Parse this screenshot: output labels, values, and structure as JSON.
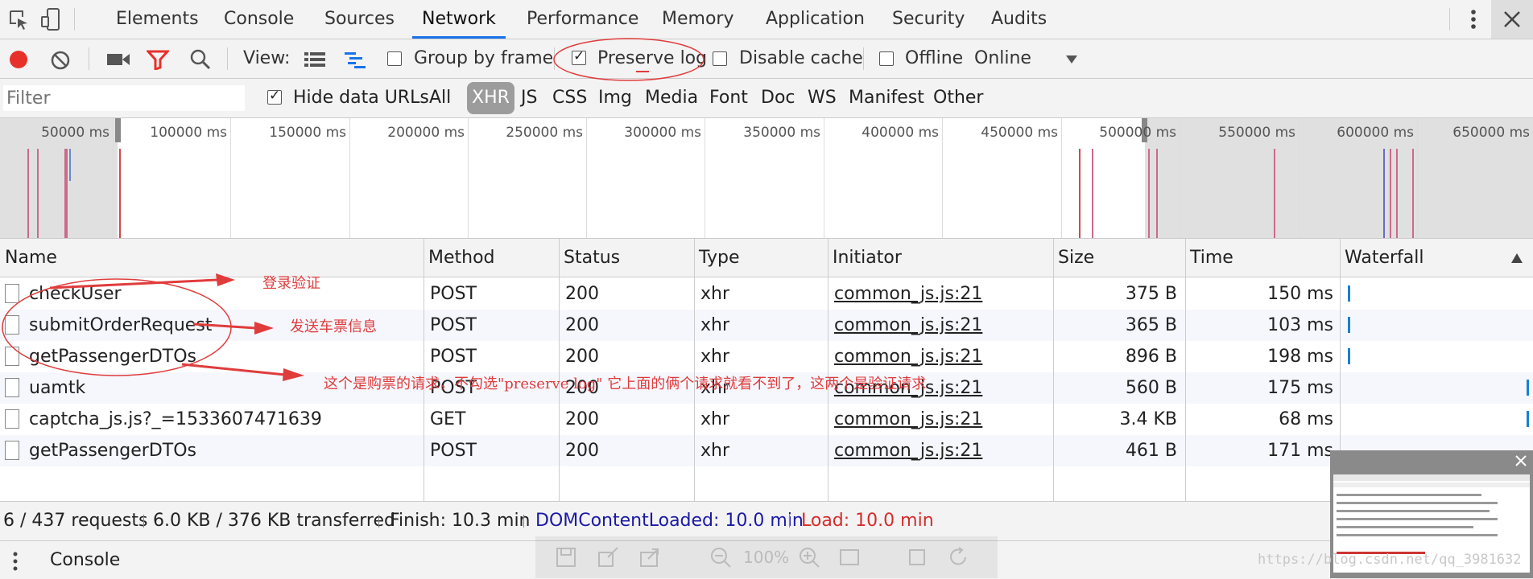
{
  "tabs": {
    "items": [
      "Elements",
      "Console",
      "Sources",
      "Network",
      "Performance",
      "Memory",
      "Application",
      "Security",
      "Audits"
    ],
    "active": "Network"
  },
  "toolbar": {
    "view_label": "View:",
    "group_by_frame": "Group by frame",
    "preserve_log": "Preserve log",
    "disable_cache": "Disable cache",
    "offline": "Offline",
    "throttle": "Online"
  },
  "filter": {
    "placeholder": "Filter",
    "hide_data_urls": "Hide data URLs",
    "types": [
      "All",
      "XHR",
      "JS",
      "CSS",
      "Img",
      "Media",
      "Font",
      "Doc",
      "WS",
      "Manifest",
      "Other"
    ],
    "active_type": "XHR"
  },
  "overview": {
    "ticks": [
      "50000 ms",
      "100000 ms",
      "150000 ms",
      "200000 ms",
      "250000 ms",
      "300000 ms",
      "350000 ms",
      "400000 ms",
      "450000 ms",
      "500000 ms",
      "550000 ms",
      "600000 ms",
      "650000 ms"
    ]
  },
  "table": {
    "headers": {
      "name": "Name",
      "method": "Method",
      "status": "Status",
      "type": "Type",
      "initiator": "Initiator",
      "size": "Size",
      "time": "Time",
      "waterfall": "Waterfall"
    },
    "rows": [
      {
        "name": "checkUser",
        "method": "POST",
        "status": "200",
        "type": "xhr",
        "initiator": "common_js.js:21",
        "size": "375 B",
        "time": "150 ms"
      },
      {
        "name": "submitOrderRequest",
        "method": "POST",
        "status": "200",
        "type": "xhr",
        "initiator": "common_js.js:21",
        "size": "365 B",
        "time": "103 ms"
      },
      {
        "name": "getPassengerDTOs",
        "method": "POST",
        "status": "200",
        "type": "xhr",
        "initiator": "common_js.js:21",
        "size": "896 B",
        "time": "198 ms"
      },
      {
        "name": "uamtk",
        "method": "POST",
        "status": "200",
        "type": "xhr",
        "initiator": "common_js.js:21",
        "size": "560 B",
        "time": "175 ms"
      },
      {
        "name": "captcha_js.js?_=1533607471639",
        "method": "GET",
        "status": "200",
        "type": "xhr",
        "initiator": "common_js.js:21",
        "size": "3.4 KB",
        "time": "68 ms"
      },
      {
        "name": "getPassengerDTOs",
        "method": "POST",
        "status": "200",
        "type": "xhr",
        "initiator": "common_js.js:21",
        "size": "461 B",
        "time": "171 ms"
      }
    ]
  },
  "summary": {
    "requests": "6 / 437 requests",
    "transferred": "6.0 KB / 376 KB transferred",
    "finish": "Finish: 10.3 min",
    "dom_loaded": "DOMContentLoaded: 10.0 min",
    "load": "Load: 10.0 min"
  },
  "drawer": {
    "console_label": "Console"
  },
  "zoom": {
    "level": "100%"
  },
  "annotations": {
    "login": "登录验证",
    "send": "发送车票信息",
    "note": "这个是购票的请求，不勾选\"preserve log\" 它上面的俩个请求就看不到了，这两个是验证请求"
  },
  "watermark": "https://blog.csdn.net/qq_3981632",
  "colors": {
    "record_red": "#e8302b",
    "active_tab_blue": "#1a73e8",
    "dom_blue": "#1a1aa6",
    "load_red": "#d62b2b",
    "annotation_red": "#e03c3c",
    "waterfall_blue": "#1a7fd4"
  }
}
